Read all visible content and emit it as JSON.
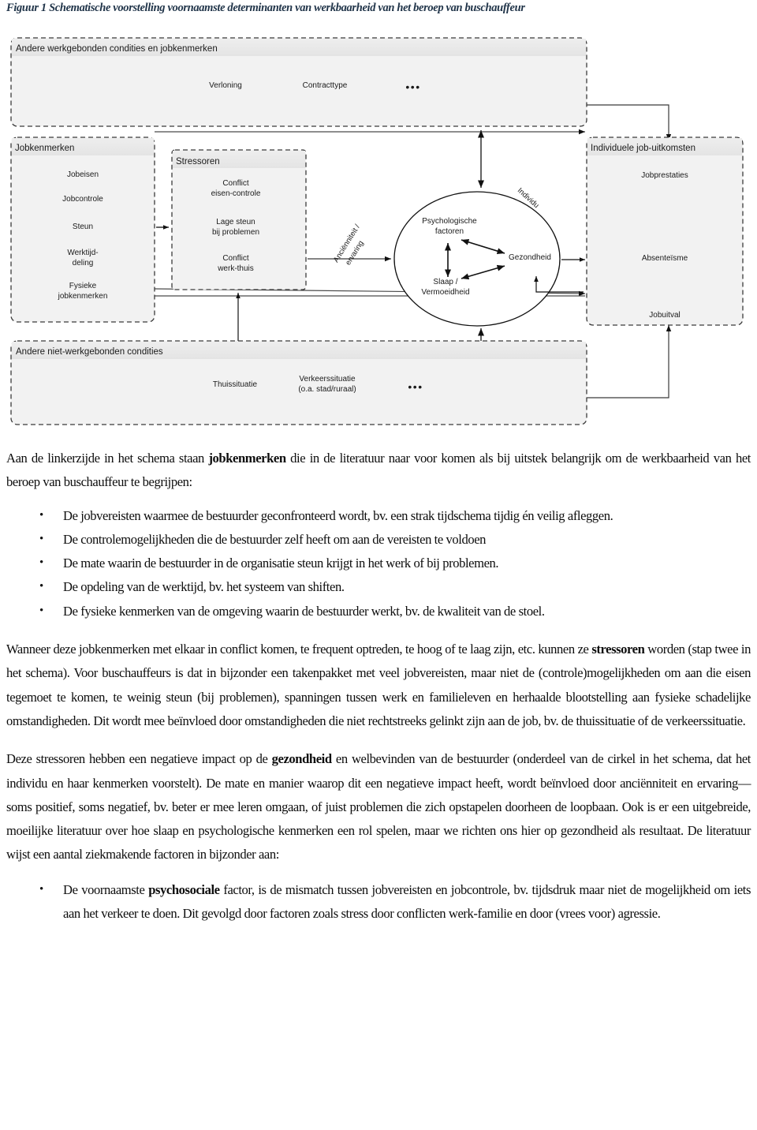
{
  "caption": "Figuur 1 Schematische voorstelling voornaamste determinanten van werkbaarheid van het beroep van buschauffeur",
  "diagram": {
    "boxes": {
      "work_conditions": {
        "title": "Andere werkgebonden condities en jobkenmerken",
        "items": [
          "Verloning",
          "Contracttype"
        ],
        "ellipsis": "•••"
      },
      "job_characteristics": {
        "title": "Jobkenmerken",
        "items": [
          "Jobeisen",
          "Jobcontrole",
          "Steun",
          "Werktijd-",
          "deling",
          "Fysieke",
          "jobkenmerken"
        ]
      },
      "stressors": {
        "title": "Stressoren",
        "items": [
          "Conflict",
          "eisen-controle",
          "Lage steun",
          "bij problemen",
          "Conflict",
          "werk-thuis"
        ]
      },
      "individual": {
        "label": "Individu",
        "items": [
          "Psychologische",
          "factoren",
          "Slaap /",
          "Vermoeidheid",
          "Gezondheid"
        ]
      },
      "job_outcomes": {
        "title": "Individuele job-uitkomsten",
        "items": [
          "Jobprestaties",
          "Absenteïsme",
          "Jobuitval"
        ]
      },
      "non_work_conditions": {
        "title": "Andere niet-werkgebonden condities",
        "items": [
          "Thuissituatie",
          "Verkeerssituatie",
          "(o.a. stad/ruraal)"
        ],
        "ellipsis": "•••"
      }
    },
    "edge_labels": {
      "seniority_line1": "Anciënniteit /",
      "seniority_line2": "ervaring"
    },
    "colors": {
      "box_fill": "#f2f2f2",
      "box_header_fill": "#e8e8e8",
      "stroke": "#3a3a3a"
    }
  },
  "text": {
    "intro_1": "Aan de linkerzijde in het schema staan ",
    "intro_bold": "jobkenmerken",
    "intro_2": " die in de literatuur naar voor komen als bij uitstek belangrijk om de werkbaarheid van het beroep van buschauffeur te begrijpen:",
    "bullets_1": [
      "De jobvereisten waarmee de bestuurder geconfronteerd wordt, bv. een strak tijdschema tijdig én veilig afleggen.",
      "De controlemogelijkheden die de bestuurder zelf heeft om aan de vereisten te voldoen",
      "De mate waarin de bestuurder in de organisatie steun krijgt in het werk of bij problemen.",
      "De opdeling van de werktijd, bv. het systeem van shiften.",
      "De fysieke kenmerken van de omgeving waarin de bestuurder werkt, bv. de kwaliteit van de stoel."
    ],
    "para2_a": "Wanneer deze jobkenmerken met elkaar in conflict komen, te frequent optreden, te hoog of te laag zijn, etc. kunnen ze ",
    "para2_bold": "stressoren",
    "para2_b": " worden (stap twee in het schema). Voor buschauffeurs is dat in bijzonder een takenpakket met veel jobvereisten, maar niet de (controle)mogelijkheden om aan die eisen tegemoet te komen, te weinig steun (bij problemen), spanningen tussen werk en familieleven en herhaalde blootstelling aan fysieke schadelijke omstandigheden. Dit wordt mee beïnvloed door omstandigheden die niet rechtstreeks gelinkt zijn aan de job, bv. de thuissituatie of de verkeerssituatie.",
    "para3_a": "Deze stressoren hebben een negatieve impact op de ",
    "para3_bold": "gezondheid",
    "para3_b": " en welbevinden van de bestuurder (onderdeel van de cirkel in het schema, dat het individu en haar kenmerken voorstelt). De mate en manier waarop dit een negatieve impact heeft, wordt beïnvloed door anciënniteit en ervaring—soms positief, soms negatief, bv. beter er mee leren omgaan, of juist problemen die zich opstapelen doorheen de loopbaan. Ook is er een uitgebreide, moeilijke literatuur over hoe slaap en psychologische kenmerken een rol spelen, maar we richten ons hier op gezondheid als resultaat. De literatuur wijst een aantal ziekmakende factoren in bijzonder aan:",
    "bullet2_a": "De voornaamste ",
    "bullet2_bold": "psychosociale",
    "bullet2_b": " factor, is de mismatch tussen jobvereisten en jobcontrole, bv. tijdsdruk maar niet de mogelijkheid om iets aan het verkeer te doen. Dit gevolgd door factoren zoals stress door conflicten werk-familie en door (vrees voor) agressie."
  }
}
